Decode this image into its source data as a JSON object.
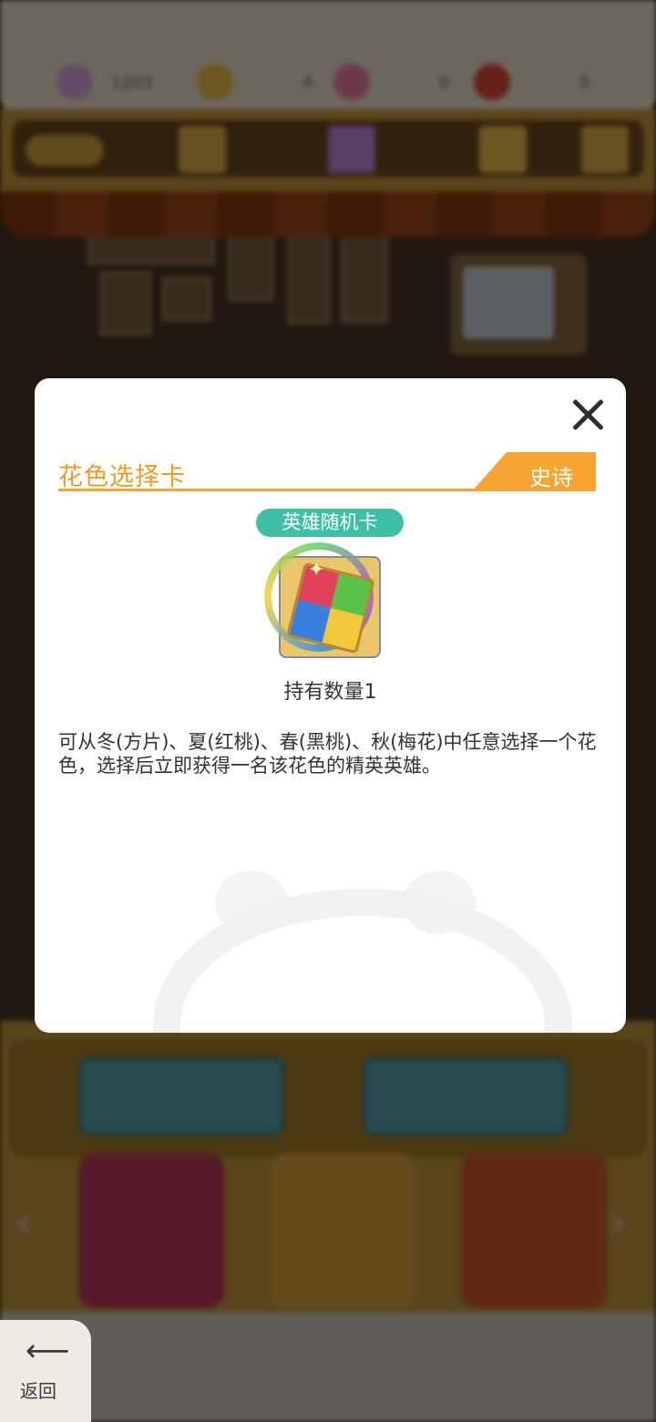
{
  "topbar": {
    "resources": [
      {
        "icon": "ice-cream-icon",
        "value": "1203",
        "color": "#d9a9e6"
      },
      {
        "icon": "ticket-icon",
        "value": "4",
        "color": "#f2c04a"
      },
      {
        "icon": "coupon-icon",
        "value": "0",
        "color": "#ef7fa8"
      },
      {
        "icon": "heart-icon",
        "value": "5",
        "color": "#e04a3a"
      }
    ]
  },
  "modal": {
    "title": "花色选择卡",
    "rarity": "史诗",
    "card_type": "英雄随机卡",
    "quantity_label": "持有数量1",
    "description": "可从冬(方片)、夏(红桃)、春(黑桃)、秋(梅花)中任意选择一个花色，选择后立即获得一名该花色的精英英雄。",
    "close_icon": "close-icon"
  },
  "nav": {
    "back_label": "返回",
    "back_icon": "arrow-left-icon"
  },
  "colors": {
    "accent": "#f39a1a",
    "badge": "#3fbfa6",
    "rarity_tag": "#f6a533"
  }
}
